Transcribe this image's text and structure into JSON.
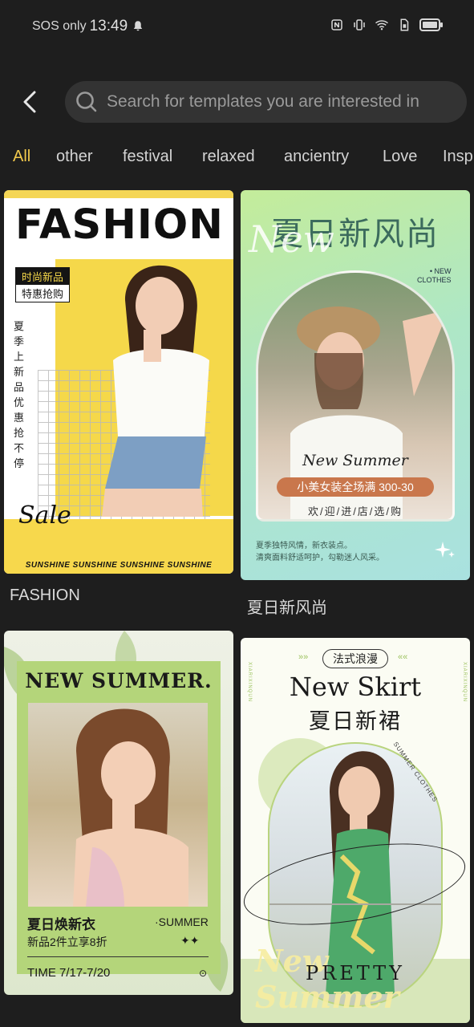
{
  "status_bar": {
    "carrier": "SOS only",
    "time": "13:49"
  },
  "search": {
    "placeholder": "Search for templates you are interested in"
  },
  "tabs": [
    {
      "label": "All",
      "active": true
    },
    {
      "label": "other"
    },
    {
      "label": "festival"
    },
    {
      "label": "relaxed"
    },
    {
      "label": "ancientry"
    },
    {
      "label": "Love"
    },
    {
      "label": "Insp"
    }
  ],
  "cards": [
    {
      "label": "FASHION",
      "headline": "FASHION",
      "tag1": "时尚新品",
      "tag2": "特惠抢购",
      "vertical_text": "夏季上新品优惠抢不停",
      "script": "Sale",
      "band": "SUNSHINE  SUNSHINE  SUNSHINE  SUNSHINE"
    },
    {
      "label": "夏日新风尚",
      "title": "夏日新风尚",
      "script": "New",
      "badge": "• NEW\nCLOTHES",
      "subtitle": "New Summer",
      "promo": "小美女装全场满 300-30",
      "welcome": "欢/迎/进/店/选/购",
      "desc1": "夏季独特风情，新衣装点。",
      "desc2": "清爽面料舒适呵护，勾勒迷人风采。"
    },
    {
      "headline": "NEW SUMMER.",
      "cn_title": "夏日焕新衣",
      "cn_promo": "新品2件立享8折",
      "summer": "·SUMMER",
      "time": "TIME 7/17-7/20"
    },
    {
      "badge": "法式浪漫",
      "title_en": "New Skirt",
      "title_cn": "夏日新裙",
      "curved": "SUMMER CLOTHES",
      "side_text": "XIARIXINQUN",
      "script": "New Summer",
      "bottom": "PRETTY"
    }
  ],
  "colors": {
    "accent": "#f2c94c",
    "background": "#1e1e1e",
    "search_bg": "#333333"
  }
}
